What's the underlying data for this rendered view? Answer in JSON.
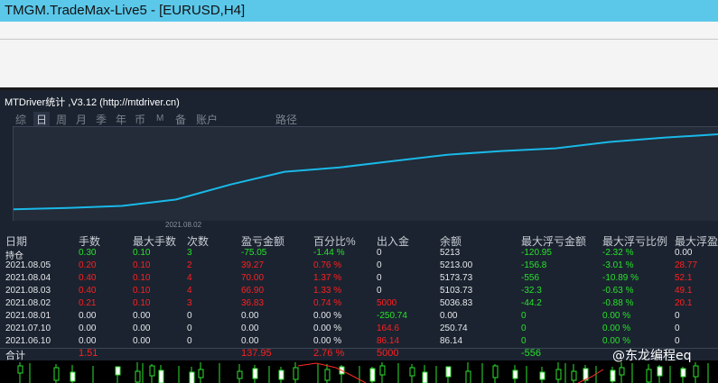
{
  "window": {
    "title": "TMGM.TradeMax-Live5 - [EURUSD,H4]"
  },
  "panel": {
    "title": "MTDriver统计 ,V3.12 (http://mtdriver.cn)",
    "tabs": [
      "综",
      "日",
      "周",
      "月",
      "季",
      "年",
      "币",
      "M",
      "备",
      "账户",
      "路径"
    ],
    "active_tab": "日"
  },
  "chart_data": {
    "type": "line",
    "x_tick_labels": [
      "2021.08.02"
    ],
    "series": [
      {
        "values": [
          5036.83,
          5040,
          5045,
          5060,
          5095,
          5125,
          5135,
          5150,
          5165,
          5173.73,
          5180,
          5195,
          5205,
          5213
        ]
      }
    ],
    "ylim": [
      5010,
      5230
    ],
    "color": "#1ab8e8",
    "grid": false
  },
  "table": {
    "headers": [
      "日期",
      "手数",
      "最大手数",
      "次数",
      "盈亏金额",
      "百分比%",
      "出入金",
      "余额",
      "最大浮亏金额",
      "最大浮亏比例",
      "最大浮盈"
    ],
    "rows": [
      {
        "date": "持仓",
        "lots": "0.30",
        "max_lots": "0.10",
        "count": "3",
        "pnl": "-75.05",
        "pct": "-1.44 %",
        "io": "0",
        "balance": "5213",
        "max_float_loss": "-120.95",
        "max_float_ratio": "-2.32 %",
        "max_float_profit": "0.00"
      },
      {
        "date": "2021.08.05",
        "lots": "0.20",
        "max_lots": "0.10",
        "count": "2",
        "pnl": "39.27",
        "pct": "0.76 %",
        "io": "0",
        "balance": "5213.00",
        "max_float_loss": "-156.8",
        "max_float_ratio": "-3.01 %",
        "max_float_profit": "28.77"
      },
      {
        "date": "2021.08.04",
        "lots": "0.40",
        "max_lots": "0.10",
        "count": "4",
        "pnl": "70.00",
        "pct": "1.37 %",
        "io": "0",
        "balance": "5173.73",
        "max_float_loss": "-556",
        "max_float_ratio": "-10.89 %",
        "max_float_profit": "52.1"
      },
      {
        "date": "2021.08.03",
        "lots": "0.40",
        "max_lots": "0.10",
        "count": "4",
        "pnl": "66.90",
        "pct": "1.33 %",
        "io": "0",
        "balance": "5103.73",
        "max_float_loss": "-32.3",
        "max_float_ratio": "-0.63 %",
        "max_float_profit": "49.1"
      },
      {
        "date": "2021.08.02",
        "lots": "0.21",
        "max_lots": "0.10",
        "count": "3",
        "pnl": "36.83",
        "pct": "0.74 %",
        "io": "5000",
        "balance": "5036.83",
        "max_float_loss": "-44.2",
        "max_float_ratio": "-0.88 %",
        "max_float_profit": "20.1"
      },
      {
        "date": "2021.08.01",
        "lots": "0.00",
        "max_lots": "0.00",
        "count": "0",
        "pnl": "0.00",
        "pct": "0.00 %",
        "io": "-250.74",
        "balance": "0.00",
        "max_float_loss": "0",
        "max_float_ratio": "0.00 %",
        "max_float_profit": "0"
      },
      {
        "date": "2021.07.10",
        "lots": "0.00",
        "max_lots": "0.00",
        "count": "0",
        "pnl": "0.00",
        "pct": "0.00 %",
        "io": "164.6",
        "balance": "250.74",
        "max_float_loss": "0",
        "max_float_ratio": "0.00 %",
        "max_float_profit": "0"
      },
      {
        "date": "2021.06.10",
        "lots": "0.00",
        "max_lots": "0.00",
        "count": "0",
        "pnl": "0.00",
        "pct": "0.00 %",
        "io": "86.14",
        "balance": "86.14",
        "max_float_loss": "0",
        "max_float_ratio": "0.00 %",
        "max_float_profit": "0"
      }
    ],
    "total": {
      "date": "合计",
      "lots": "1.51",
      "pnl": "137.95",
      "pct": "2.76 %",
      "io": "5000",
      "max_float_loss": "-556"
    }
  },
  "watermark": "@东龙编程eq",
  "colors": {
    "positive": "#ff2020",
    "negative": "#27e22a",
    "neutral": "#e6e8eb",
    "line": "#1ab8e8",
    "panel_bg": "#1b2330"
  }
}
